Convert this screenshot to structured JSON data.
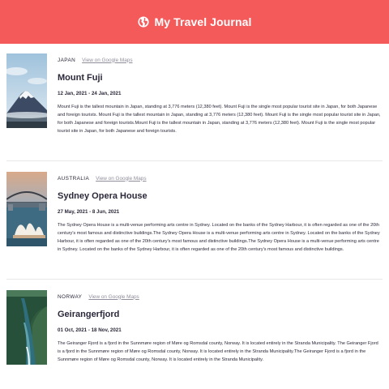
{
  "header": {
    "title": "My Travel Journal",
    "icon": "globe-icon",
    "bg": "#f55a5a"
  },
  "entries": [
    {
      "country": "JAPAN",
      "map_link": "View on Google Maps",
      "title": "Mount Fuji",
      "dates": "12 Jan, 2021 - 24 Jan, 2021",
      "description": "Mount Fuji is the tallest mountain in Japan, standing at 3,776 meters (12,380 feet). Mount Fuji is the single most popular tourist site in Japan, for both Japanese and foreign tourists. Mount Fuji is the tallest mountain in Japan, standing at 3,776 meters (12,380 feet). Mount Fuji is the single most popular tourist site in Japan, for both Japanese and foreign tourists.Mount Fuji is the tallest mountain in Japan, standing at 3,776 meters (12,380 feet). Mount Fuji is the single most popular tourist site in Japan, for both Japanese and foreign tourists."
    },
    {
      "country": "AUSTRALIA",
      "map_link": "View on Google Maps",
      "title": "Sydney Opera House",
      "dates": "27 May, 2021 - 8 Jun, 2021",
      "description": "The Sydney Opera House is a multi-venue performing arts centre in Sydney. Located on the banks of the Sydney Harbour, it is often regarded as one of the 20th century's most famous and distinctive buildings.The Sydney Opera House is a multi-venue performing arts centre in Sydney. Located on the banks of the Sydney Harbour, it is often regarded as one of the 20th century's most famous and distinctive buildings.The Sydney Opera House is a multi-venue performing arts centre in Sydney. Located on the banks of the Sydney Harbour, it is often regarded as one of the 20th century's most famous and distinctive buildings."
    },
    {
      "country": "NORWAY",
      "map_link": "View on Google Maps",
      "title": "Geirangerfjord",
      "dates": "01 Oct, 2021 - 18 Nov, 2021",
      "description": "The Geiranger Fjord is a fjord in the Sunnmøre region of Møre og Romsdal county, Norway. It is located entirely in the Stranda Municipality. The Geiranger Fjord is a fjord in the Sunnmøre region of Møre og Romsdal county, Norway. It is located entirely in the Stranda Municipality.The Geiranger Fjord is a fjord in the Sunnmøre region of Møre og Romsdal county, Norway. It is located entirely in the Stranda Municipality."
    }
  ]
}
